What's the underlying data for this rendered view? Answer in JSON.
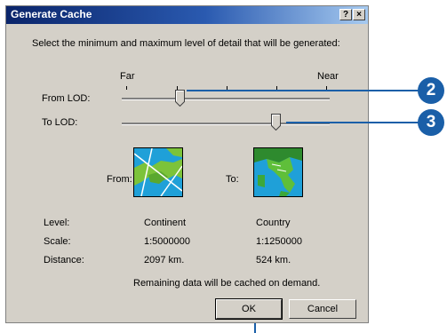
{
  "window": {
    "title": "Generate Cache",
    "help_label": "?",
    "close_label": "×"
  },
  "instructions": "Select the minimum and maximum level of detail that will be generated:",
  "scale_labels": {
    "far": "Far",
    "near": "Near"
  },
  "sliders": {
    "from": {
      "label": "From LOD:",
      "value_fraction": 0.28
    },
    "to": {
      "label": "To LOD:",
      "value_fraction": 0.74
    }
  },
  "preview": {
    "from_label": "From:",
    "to_label": "To:",
    "from_icon": "europe-map-icon",
    "to_icon": "italy-map-icon"
  },
  "details": {
    "labels": [
      "Level:",
      "Scale:",
      "Distance:"
    ],
    "from_values": [
      "Continent",
      "1:5000000",
      "2097 km."
    ],
    "to_values": [
      "Country",
      "1:1250000",
      "524 km."
    ]
  },
  "remaining_note": "Remaining data will be cached on demand.",
  "buttons": {
    "ok": "OK",
    "cancel": "Cancel"
  },
  "callouts": [
    "2",
    "3"
  ],
  "colors": {
    "callout": "#1a5fa8",
    "title_start": "#0a246a",
    "dialog_bg": "#d4d0c8"
  }
}
